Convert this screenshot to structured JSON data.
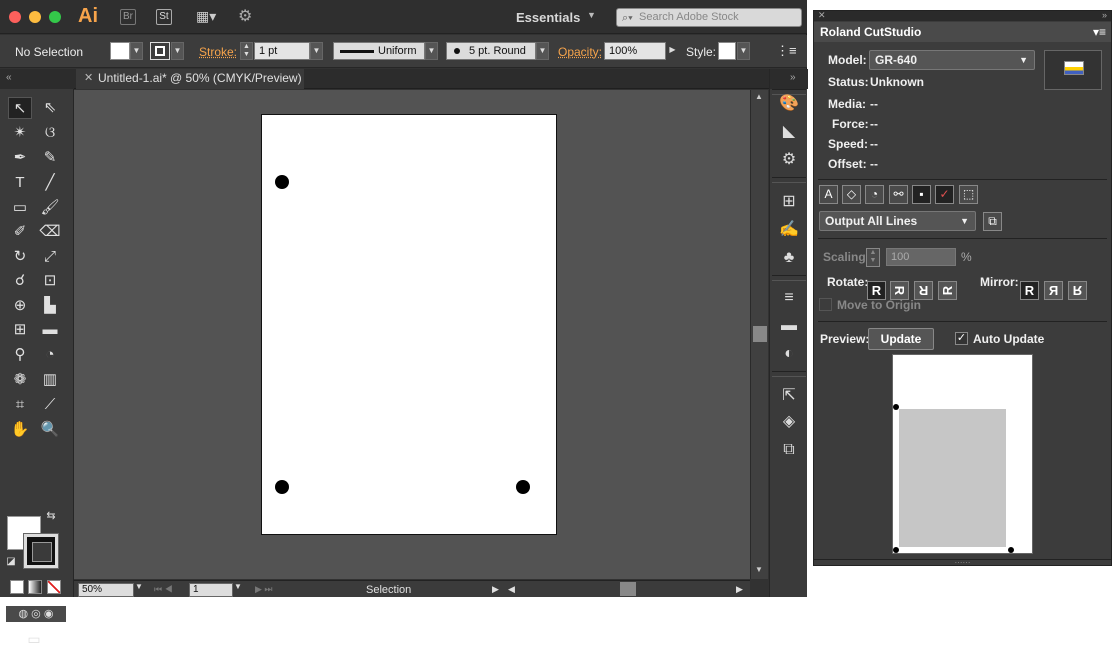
{
  "titlebar": {
    "app_logo": "Ai",
    "bridge": "Br",
    "stock": "St",
    "workspace": "Essentials",
    "search_placeholder": "Search Adobe Stock"
  },
  "controlbar": {
    "selection": "No Selection",
    "stroke_label": "Stroke:",
    "stroke_weight": "1 pt",
    "profile": "Uniform",
    "brush": "5 pt. Round",
    "opacity_label": "Opacity:",
    "opacity": "100%",
    "style_label": "Style:"
  },
  "document": {
    "tab_title": "Untitled-1.ai* @ 50% (CMYK/Preview)"
  },
  "statusbar": {
    "zoom": "50%",
    "artboard": "1",
    "tool": "Selection"
  },
  "cutstudio": {
    "title": "Roland CutStudio",
    "model_label": "Model:",
    "model": "GR-640",
    "status_label": "Status:",
    "status": "Unknown",
    "media_label": "Media:",
    "media": "--",
    "force_label": "Force:",
    "force": "--",
    "speed_label": "Speed:",
    "speed": "--",
    "offset_label": "Offset:",
    "offset": "--",
    "output": "Output All Lines",
    "scaling_label": "Scaling:",
    "scaling": "100",
    "scaling_unit": "%",
    "rotate_label": "Rotate:",
    "mirror_label": "Mirror:",
    "move_origin": "Move to Origin",
    "preview_label": "Preview:",
    "update": "Update",
    "auto_update": "Auto Update"
  },
  "colors": {
    "accent": "#f7a44b",
    "bg": "#323232",
    "canvas": "#535353"
  }
}
